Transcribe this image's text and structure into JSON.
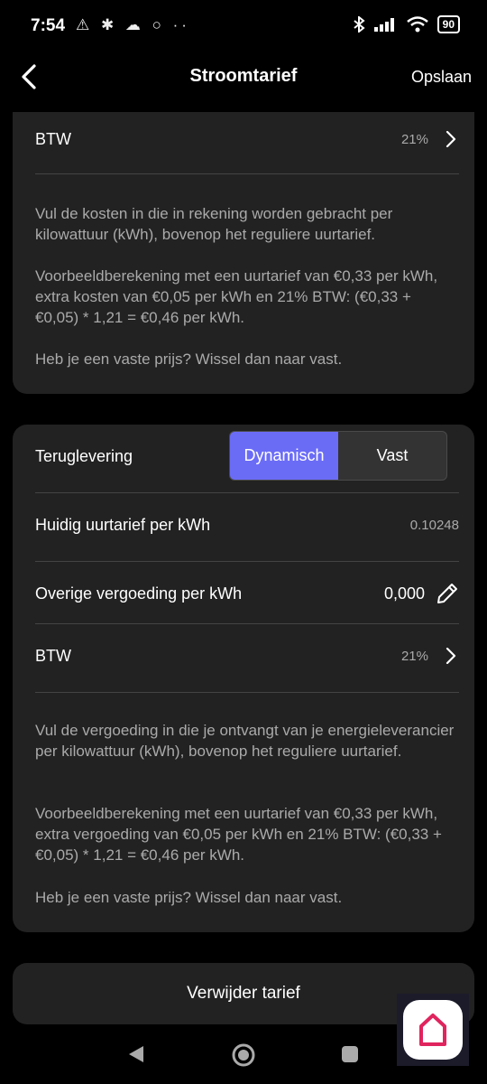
{
  "status": {
    "time": "7:54",
    "icons": "⚠ ✱ ☁ ○ ··",
    "battery": "90"
  },
  "header": {
    "title": "Stroomtarief",
    "save_label": "Opslaan"
  },
  "card1": {
    "btw_label": "BTW",
    "btw_value": "21%",
    "para1": "Vul de kosten in die in rekening worden gebracht per kilowattuur (kWh), bovenop het reguliere uurtarief.",
    "para2": "Voorbeeldberekening met een uurtarief van €0,33 per kWh, extra kosten van €0,05 per kWh en 21% BTW: (€0,33 + €0,05) * 1,21 = €0,46 per kWh.",
    "para3": "Heb je een vaste prijs? Wissel dan naar vast."
  },
  "card2": {
    "terug_label": "Teruglevering",
    "seg_options": [
      "Dynamisch",
      "Vast"
    ],
    "seg_selected": "Dynamisch",
    "huidig_label": "Huidig uurtarief per kWh",
    "huidig_value": "0.10248",
    "overige_label": "Overige vergoeding per kWh",
    "overige_value": "0,000",
    "btw_label": "BTW",
    "btw_value": "21%",
    "para1": "Vul de vergoeding in die je ontvangt van je energieleverancier per kilowattuur (kWh), bovenop het reguliere uurtarief.",
    "para2": "Voorbeeldberekening met een uurtarief van €0,33 per kWh, extra vergoeding van €0,05 per kWh en 21% BTW: (€0,33 + €0,05) * 1,21 = €0,46 per kWh.",
    "para3": "Heb je een vaste prijs? Wissel dan naar vast."
  },
  "delete_label": "Verwijder tarief",
  "accent_color": "#6b6cf6"
}
